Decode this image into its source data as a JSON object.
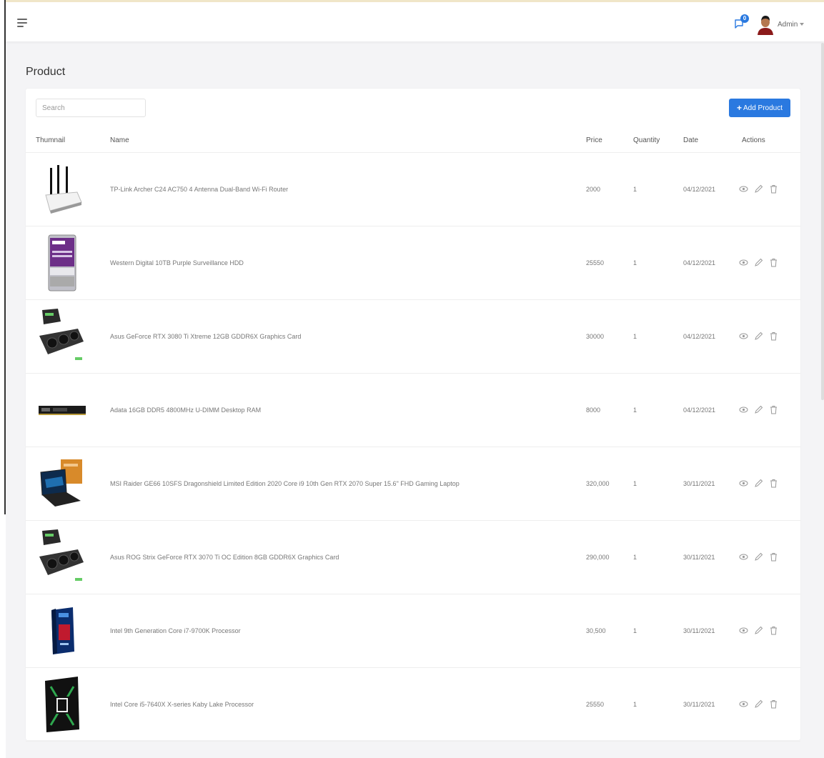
{
  "header": {
    "notification_count": "0",
    "user_label": "Admin"
  },
  "page": {
    "title": "Product"
  },
  "toolbar": {
    "search_placeholder": "Search",
    "add_label": "Add Product",
    "add_plus": "+"
  },
  "table": {
    "columns": {
      "thumbnail": "Thumnail",
      "name": "Name",
      "price": "Price",
      "quantity": "Quantity",
      "date": "Date",
      "actions": "Actions"
    },
    "rows": [
      {
        "thumb": "router",
        "name": "TP-Link Archer C24 AC750 4 Antenna Dual-Band Wi-Fi Router",
        "price": "2000",
        "quantity": "1",
        "date": "04/12/2021"
      },
      {
        "thumb": "hdd",
        "name": "Western Digital 10TB Purple Surveillance HDD",
        "price": "25550",
        "quantity": "1",
        "date": "04/12/2021"
      },
      {
        "thumb": "gpu",
        "name": "Asus GeForce RTX 3080 Ti Xtreme 12GB GDDR6X Graphics Card",
        "price": "30000",
        "quantity": "1",
        "date": "04/12/2021"
      },
      {
        "thumb": "ram",
        "name": "Adata 16GB DDR5 4800MHz U-DIMM Desktop RAM",
        "price": "8000",
        "quantity": "1",
        "date": "04/12/2021"
      },
      {
        "thumb": "laptop",
        "name": "MSI Raider GE66 10SFS Dragonshield Limited Edition 2020 Core i9 10th Gen RTX 2070 Super 15.6\" FHD Gaming Laptop",
        "price": "320,000",
        "quantity": "1",
        "date": "30/11/2021"
      },
      {
        "thumb": "gpu",
        "name": "Asus ROG Strix GeForce RTX 3070 Ti OC Edition 8GB GDDR6X Graphics Card",
        "price": "290,000",
        "quantity": "1",
        "date": "30/11/2021"
      },
      {
        "thumb": "cpu-box",
        "name": "Intel 9th Generation Core i7-9700K Processor",
        "price": "30,500",
        "quantity": "1",
        "date": "30/11/2021"
      },
      {
        "thumb": "cpu-i5",
        "name": "Intel Core i5-7640X X-series Kaby Lake Processor",
        "price": "25550",
        "quantity": "1",
        "date": "30/11/2021"
      }
    ]
  },
  "colors": {
    "accent": "#2a79e0",
    "background": "#f4f4f6"
  }
}
